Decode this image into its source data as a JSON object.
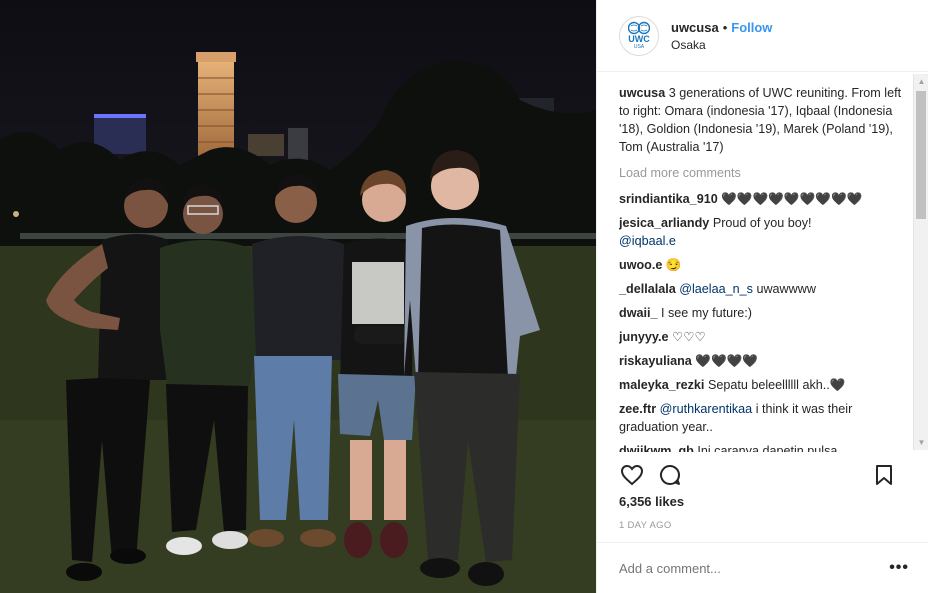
{
  "post": {
    "username": "uwcusa",
    "separator": "•",
    "follow_label": "Follow",
    "location": "Osaka",
    "avatar": {
      "mark": "UWC",
      "sub": "USA"
    },
    "caption_user": "uwcusa",
    "caption_text": "3 generations of UWC reuniting. From left to right: Omara (indonesia '17), Iqbaal (Indonesia '18), Goldion (Indonesia '19), Marek (Poland '19), Tom (Australia '17)",
    "load_more": "Load more comments",
    "comments": [
      {
        "user": "srindiantika_910",
        "text": "🖤🖤🖤🖤🖤🖤🖤🖤🖤",
        "mention": ""
      },
      {
        "user": "jesica_arliandy",
        "text": "Proud of you boy!",
        "mention": "@iqbaal.e"
      },
      {
        "user": "uwoo.e",
        "text": "😏",
        "mention": ""
      },
      {
        "user": "_dellalala",
        "text": "uwawwww",
        "mention": "@laelaa_n_s"
      },
      {
        "user": "dwaii_",
        "text": "I see my future:)",
        "mention": ""
      },
      {
        "user": "junyyy.e",
        "text": "♡♡♡",
        "mention": ""
      },
      {
        "user": "riskayuliana",
        "text": "🖤🖤🖤🖤",
        "mention": ""
      },
      {
        "user": "maleyka_rezki",
        "text": "Sepatu beleellllll akh..🖤",
        "mention": ""
      },
      {
        "user": "zee.ftr",
        "text": "i think it was their graduation year..",
        "mention": "@ruthkarentikaa"
      },
      {
        "user": "dwiikwm_gb",
        "text": "Ini caranya dapetin pulsa",
        "mention": ""
      }
    ],
    "likes": "6,356 likes",
    "timestamp": "1 DAY AGO",
    "add_comment_placeholder": "Add a comment...",
    "more_label": "•••"
  },
  "icons": {
    "like": "heart-icon",
    "comment": "comment-bubble-icon",
    "save": "bookmark-icon",
    "more": "more-options-icon"
  },
  "colors": {
    "follow": "#3897f0",
    "mention": "#003569",
    "muted": "#999999",
    "uwc_blue": "#1b75bb"
  }
}
